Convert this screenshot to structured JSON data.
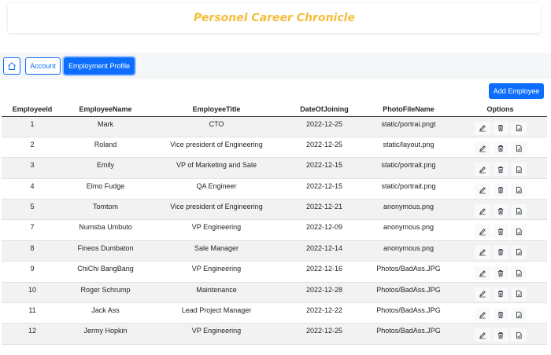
{
  "header": {
    "title": "Personel Career Chronicle"
  },
  "nav": {
    "home_icon": "home-icon",
    "account_label": "Account",
    "employment_label": "Employment Profile"
  },
  "toolbar": {
    "add_label": "Add Employee"
  },
  "table": {
    "columns": [
      "EmployeeId",
      "EmployeeName",
      "EmployeeTitle",
      "DateOfJoining",
      "PhotoFileName",
      "Options"
    ],
    "rows": [
      {
        "id": "1",
        "name": "Mark",
        "title": "CTO",
        "date": "2022-12-25",
        "photo": "static/portrai.pngt"
      },
      {
        "id": "2",
        "name": "Roland",
        "title": "Vice president of Engineering",
        "date": "2022-12-25",
        "photo": "static/layout.png"
      },
      {
        "id": "3",
        "name": "Emily",
        "title": "VP of Marketing and Sale",
        "date": "2022-12-15",
        "photo": "static/portrait.png"
      },
      {
        "id": "4",
        "name": "Elmo Fudge",
        "title": "QA Engineer",
        "date": "2022-12-15",
        "photo": "static/portrait.png"
      },
      {
        "id": "5",
        "name": "Tomtom",
        "title": "Vice president of Engineering",
        "date": "2022-12-21",
        "photo": "anonymous.png"
      },
      {
        "id": "7",
        "name": "Numsba Umbuto",
        "title": "VP Engineering",
        "date": "2022-12-09",
        "photo": "anonymous.png"
      },
      {
        "id": "8",
        "name": "Fineos Dumbaton",
        "title": "Sale Manager",
        "date": "2022-12-14",
        "photo": "anonymous.png"
      },
      {
        "id": "9",
        "name": "ChiChi BangBang",
        "title": "VP Engineering",
        "date": "2022-12-16",
        "photo": "Photos/BadAss.JPG"
      },
      {
        "id": "10",
        "name": "Roger Schrump",
        "title": "Maintenance",
        "date": "2022-12-28",
        "photo": "Photos/BadAss.JPG"
      },
      {
        "id": "11",
        "name": "Jack Ass",
        "title": "Lead Project Manager",
        "date": "2022-12-22",
        "photo": "Photos/BadAss.JPG"
      },
      {
        "id": "12",
        "name": "Jermy Hopkin",
        "title": "VP Engineering",
        "date": "2022-12-25",
        "photo": "Photos/BadAss.JPG"
      }
    ],
    "option_icons": [
      "edit-icon",
      "trash-icon",
      "document-icon"
    ]
  },
  "colors": {
    "accent": "#0d6efd",
    "title": "#f6bd3b",
    "stripe": "#f2f2f2"
  }
}
